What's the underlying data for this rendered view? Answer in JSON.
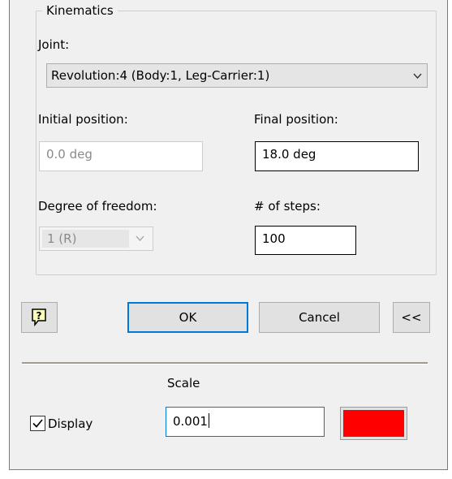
{
  "kinematics": {
    "group_title": "Kinematics",
    "joint_label": "Joint:",
    "joint_value": "Revolution:4 (Body:1, Leg-Carrier:1)",
    "initial_position_label": "Initial position:",
    "initial_position_value": "0.0 deg",
    "final_position_label": "Final position:",
    "final_position_value": "18.0 deg",
    "dof_label": "Degree of freedom:",
    "dof_value": "1 (R)",
    "steps_label": "# of steps:",
    "steps_value": "100"
  },
  "buttons": {
    "help_icon": "help-icon",
    "ok": "OK",
    "cancel": "Cancel",
    "collapse": "<<"
  },
  "display": {
    "scale_label": "Scale",
    "display_label": "Display",
    "display_checked": true,
    "scale_value": "0.001",
    "color": "#ff0000"
  },
  "colors": {
    "panel_bg": "#f0f0f0",
    "focus_border": "#0078d7",
    "disabled_text": "#8a8a8a"
  }
}
